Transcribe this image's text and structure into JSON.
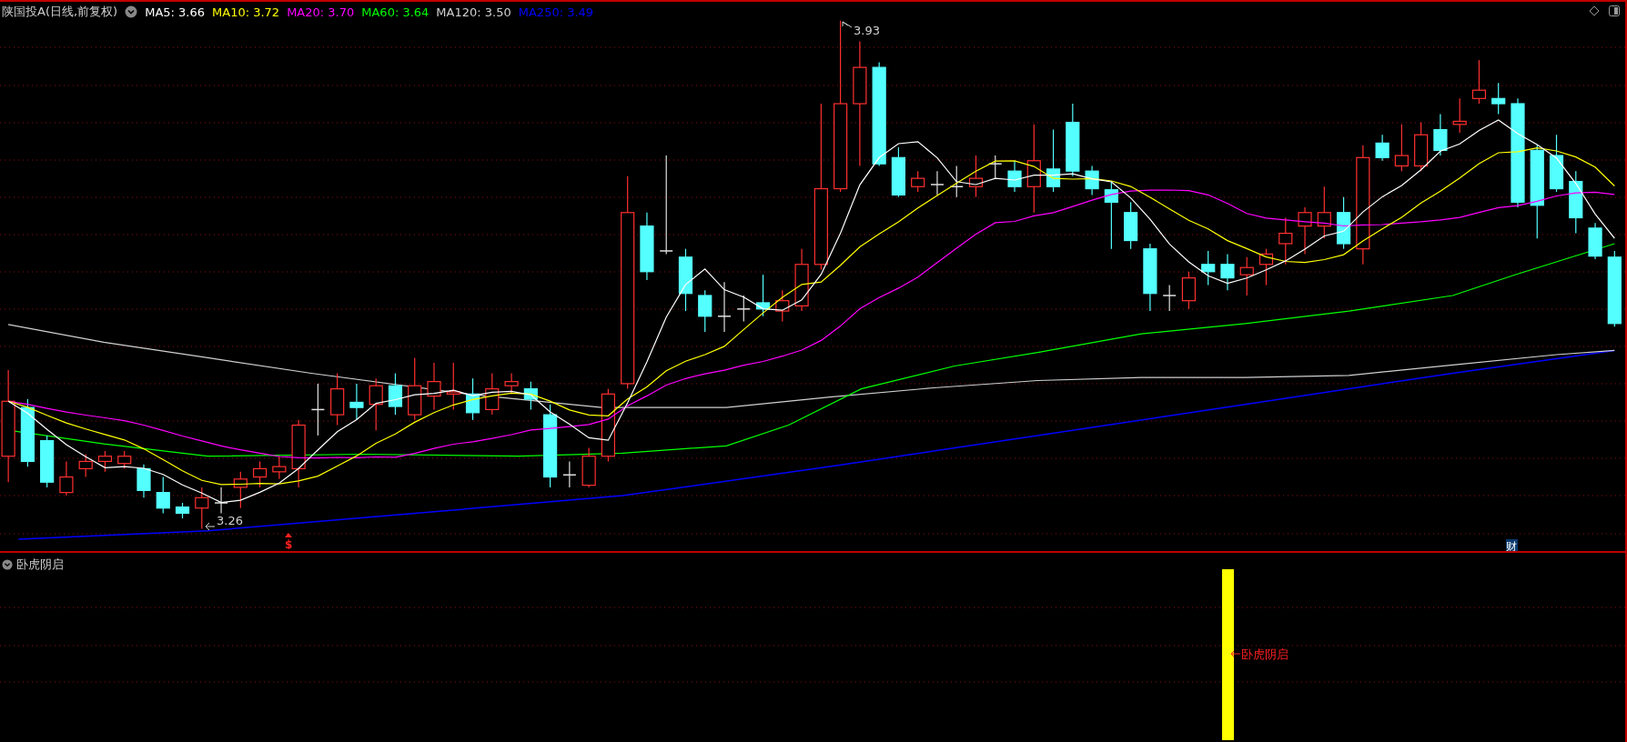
{
  "header": {
    "stock": "陕国投A",
    "period": "(日线,前复权)",
    "indicators": [
      {
        "label": "MA5: 3.66",
        "color": "#ffffff"
      },
      {
        "label": "MA10: 3.72",
        "color": "#ffff00"
      },
      {
        "label": "MA20: 3.70",
        "color": "#ff00ff"
      },
      {
        "label": "MA60: 3.64",
        "color": "#00ff00"
      },
      {
        "label": "MA120: 3.50",
        "color": "#d0d0d0"
      },
      {
        "label": "MA250: 3.49",
        "color": "#0000ff"
      }
    ]
  },
  "markers": {
    "high": "3.93",
    "low": "3.26",
    "dividend": "$",
    "finance": "财"
  },
  "sub_panel": {
    "title": "卧虎阴启",
    "signal_label": "卧虎阴启"
  }
}
